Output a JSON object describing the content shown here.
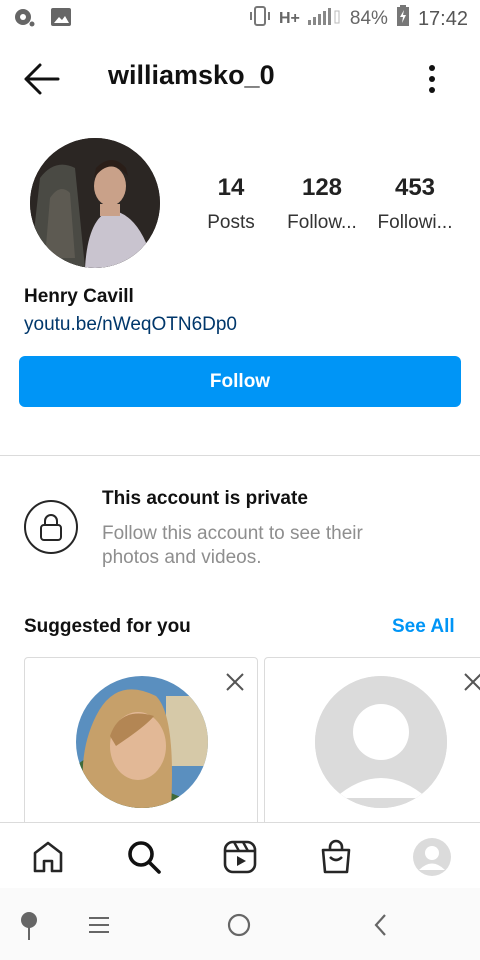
{
  "status_bar": {
    "battery": "84%",
    "network": "H+",
    "time": "17:42"
  },
  "header": {
    "username": "williamsko_0"
  },
  "profile": {
    "stats": [
      {
        "value": "14",
        "label": "Posts"
      },
      {
        "value": "128",
        "label": "Follow..."
      },
      {
        "value": "453",
        "label": "Followi..."
      }
    ],
    "name": "Henry Cavill",
    "link": "youtu.be/nWeqOTN6Dp0",
    "follow_label": "Follow"
  },
  "private_notice": {
    "title": "This account is private",
    "description": "Follow this account to see their photos and videos."
  },
  "suggested": {
    "title": "Suggested for you",
    "see_all": "See All"
  },
  "colors": {
    "accent": "#0095f6",
    "link": "#00376b",
    "muted": "#8e8e8e"
  },
  "icons": {
    "bottom_nav": [
      "home-icon",
      "search-icon",
      "reels-icon",
      "shop-icon",
      "profile-icon"
    ],
    "system_nav": [
      "assistant-icon",
      "menu-icon",
      "home-circle-icon",
      "back-chevron-icon"
    ]
  }
}
